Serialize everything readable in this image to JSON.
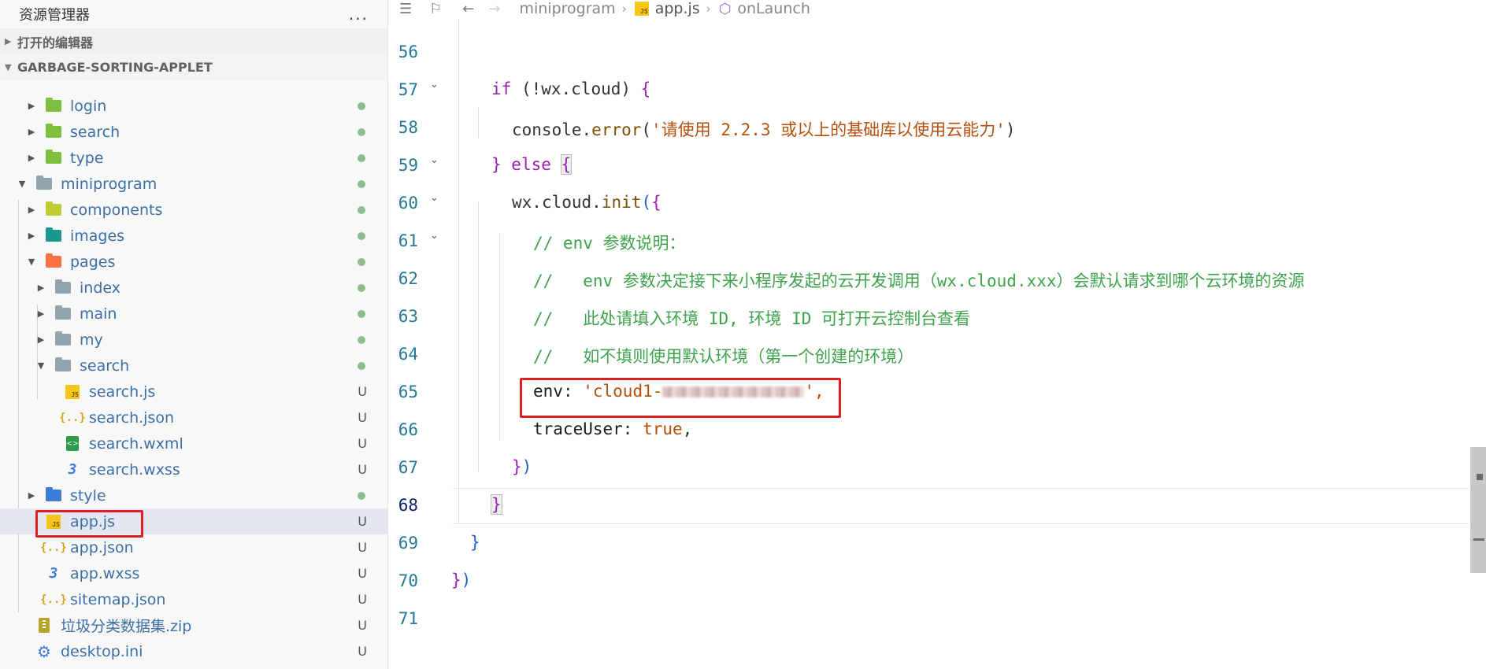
{
  "explorer": {
    "title": "资源管理器",
    "more_label": "...",
    "open_editors_label": "打开的编辑器",
    "project_label": "GARBAGE-SORTING-APPLET",
    "items": [
      {
        "label": "login",
        "icon": "folder-green-icon",
        "status": "dot"
      },
      {
        "label": "search",
        "icon": "folder-green-icon",
        "status": "dot"
      },
      {
        "label": "type",
        "icon": "folder-green-icon",
        "status": "dot"
      },
      {
        "label": "miniprogram",
        "icon": "folder-open-icon",
        "status": "dot"
      },
      {
        "label": "components",
        "icon": "folder-components-icon",
        "status": "dot"
      },
      {
        "label": "images",
        "icon": "folder-images-icon",
        "status": "dot"
      },
      {
        "label": "pages",
        "icon": "folder-pages-icon",
        "status": "dot"
      },
      {
        "label": "index",
        "icon": "folder-icon",
        "status": "dot"
      },
      {
        "label": "main",
        "icon": "folder-icon",
        "status": "dot"
      },
      {
        "label": "my",
        "icon": "folder-icon",
        "status": "dot"
      },
      {
        "label": "search",
        "icon": "folder-open-icon",
        "status": "dot"
      },
      {
        "label": "search.js",
        "icon": "js-file-icon",
        "status": "U"
      },
      {
        "label": "search.json",
        "icon": "json-file-icon",
        "status": "U"
      },
      {
        "label": "search.wxml",
        "icon": "wxml-file-icon",
        "status": "U"
      },
      {
        "label": "search.wxss",
        "icon": "css-file-icon",
        "status": "U"
      },
      {
        "label": "style",
        "icon": "folder-style-icon",
        "status": "dot"
      },
      {
        "label": "app.js",
        "icon": "js-file-icon",
        "status": "U"
      },
      {
        "label": "app.json",
        "icon": "json-file-icon",
        "status": "U"
      },
      {
        "label": "app.wxss",
        "icon": "css-file-icon",
        "status": "U"
      },
      {
        "label": "sitemap.json",
        "icon": "json-file-icon",
        "status": "U"
      },
      {
        "label": "垃圾分类数据集.zip",
        "icon": "zip-file-icon",
        "status": "U"
      },
      {
        "label": "desktop.ini",
        "icon": "gear-file-icon",
        "status": "U"
      }
    ]
  },
  "breadcrumb": {
    "folder": "miniprogram",
    "file": "app.js",
    "symbol": "onLaunch"
  },
  "code": {
    "lines": [
      {
        "no": "56"
      },
      {
        "no": "57",
        "p1": "if",
        "p2": " (!wx.cloud) ",
        "p3": "{"
      },
      {
        "no": "58",
        "p1": "console",
        "p2": ".",
        "p3": "error",
        "p4": "(",
        "p5": "'请使用 2.2.3 或以上的基础库以使用云能力'",
        "p6": ")"
      },
      {
        "no": "59",
        "p1": "}",
        "p2": " else ",
        "p3": "{"
      },
      {
        "no": "60",
        "p1": "wx",
        "p2": ".",
        "p3": "cloud",
        "p4": ".",
        "p5": "init",
        "p6": "(",
        "p7": "{"
      },
      {
        "no": "61",
        "text": "// env 参数说明："
      },
      {
        "no": "62",
        "text": "//   env 参数决定接下来小程序发起的云开发调用（wx.cloud.xxx）会默认请求到哪个云环境的资源"
      },
      {
        "no": "63",
        "text": "//   此处请填入环境 ID, 环境 ID 可打开云控制台查看"
      },
      {
        "no": "64",
        "text": "//   如不填则使用默认环境（第一个创建的环境）"
      },
      {
        "no": "65",
        "p1": "env",
        "p2": ": ",
        "p3": "'cloud1-",
        "p4": "',"
      },
      {
        "no": "66",
        "p1": "traceUser",
        "p2": ": ",
        "p3": "true",
        "p4": ","
      },
      {
        "no": "67",
        "p1": "}",
        "p2": ")"
      },
      {
        "no": "68",
        "p1": "}"
      },
      {
        "no": "69",
        "p1": "}"
      },
      {
        "no": "70",
        "p1": "}",
        "p2": ")"
      },
      {
        "no": "71"
      }
    ]
  }
}
